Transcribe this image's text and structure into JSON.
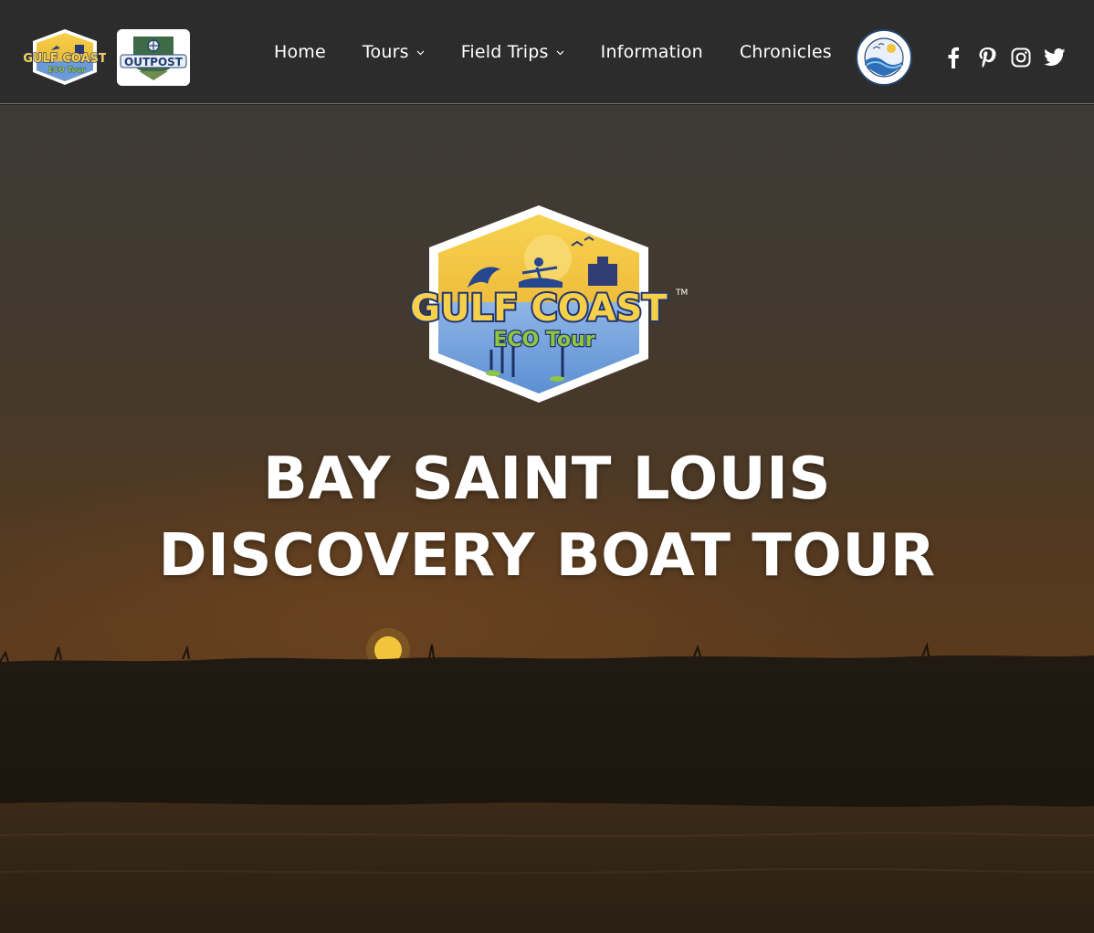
{
  "nav": {
    "items": [
      {
        "label": "Home",
        "dropdown": false
      },
      {
        "label": "Tours",
        "dropdown": true
      },
      {
        "label": "Field Trips",
        "dropdown": true
      },
      {
        "label": "Information",
        "dropdown": false
      },
      {
        "label": "Chronicles",
        "dropdown": false
      }
    ]
  },
  "brand": {
    "small_logo_text_line1": "GULF COAST",
    "small_logo_text_line2": "ECO Tour",
    "outpost_text": "OUTPOST",
    "hero_logo_line1": "GULF COAST",
    "hero_logo_line2": "ECO Tour",
    "trademark": "TM"
  },
  "social": {
    "icons": [
      "facebook-icon",
      "pinterest-icon",
      "instagram-icon",
      "twitter-icon"
    ]
  },
  "hero": {
    "title_line1": "BAY SAINT LOUIS",
    "title_line2": "DISCOVERY BOAT TOUR"
  },
  "colors": {
    "header_bg": "#2c2c2c",
    "logo_yellow": "#f2c53d",
    "logo_blue": "#3b5fb3",
    "logo_green": "#8fc63f",
    "sky_top": "#3a3733",
    "sun": "#f3c53a"
  }
}
